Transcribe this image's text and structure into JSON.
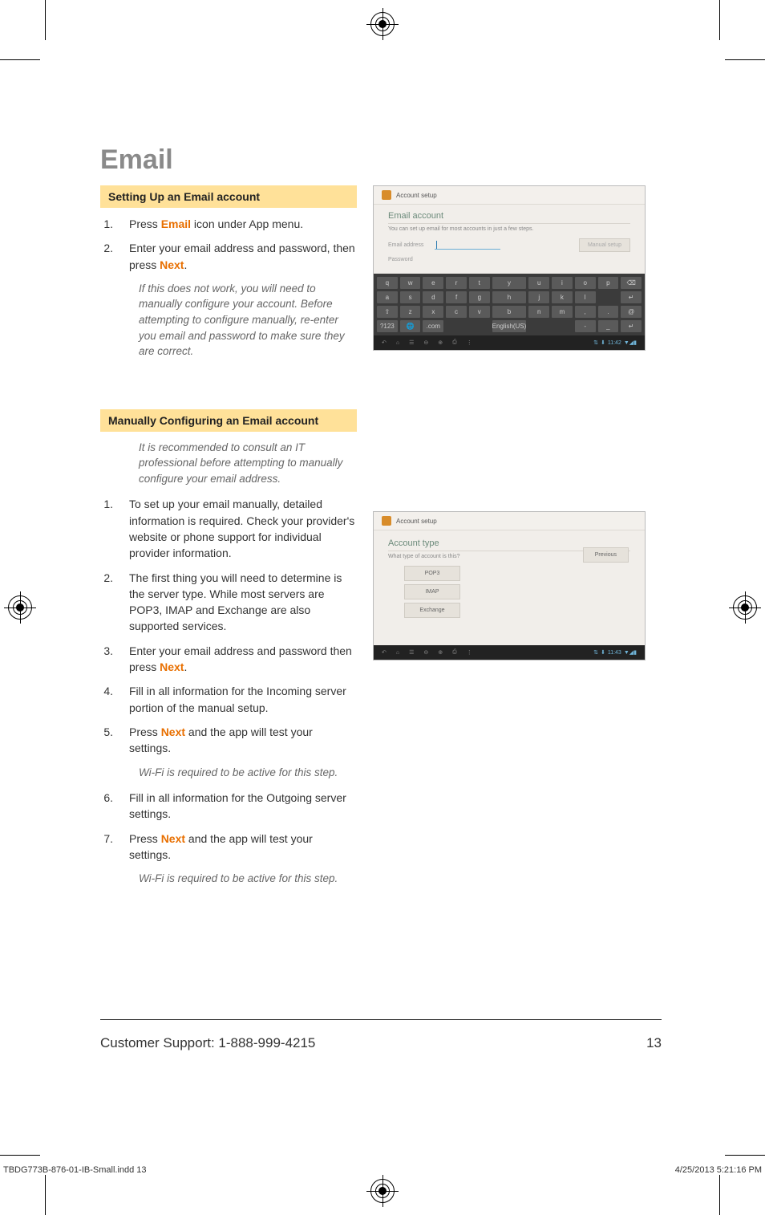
{
  "title": "Email",
  "section1": {
    "header": "Setting Up an Email account",
    "steps": [
      {
        "n": "1.",
        "pre": "Press ",
        "hl": "Email",
        "post": " icon under App menu."
      },
      {
        "n": "2.",
        "pre": "Enter your email address and password, then press ",
        "hl": "Next",
        "post": "."
      }
    ],
    "note": "If this does not work, you will need to manually configure your account. Before attempting to configure manually, re-enter you email and password to make sure they are correct."
  },
  "section2": {
    "header": "Manually Configuring an Email account",
    "intro_note": "It is recommended to consult an IT professional before attempting to manually configure your email address.",
    "steps": [
      {
        "n": "1.",
        "text": "To set up your email manually, detailed information is required. Check your provider's website or phone support for individual provider information."
      },
      {
        "n": "2.",
        "text": "The first thing you will need to determine is the server type. While most servers are POP3, IMAP and Exchange are also supported services."
      },
      {
        "n": "3.",
        "pre": "Enter your email address and password then press ",
        "hl": "Next",
        "post": "."
      },
      {
        "n": "4.",
        "text": "Fill in all information for the Incoming server portion of the manual setup."
      },
      {
        "n": "5.",
        "pre": "Press ",
        "hl": "Next",
        "post": " and the app will test your settings."
      },
      {
        "note": "Wi-Fi is required to be active for this step."
      },
      {
        "n": "6.",
        "text": "Fill in all information for the Outgoing server settings."
      },
      {
        "n": "7.",
        "pre": "Press ",
        "hl": "Next",
        "post": " and the app will test your settings."
      },
      {
        "note": "Wi-Fi is required to be active for this step."
      }
    ]
  },
  "mock1": {
    "titlebar": "Account setup",
    "heading": "Email account",
    "subtext": "You can set up email for most accounts in just a few steps.",
    "field1": "Email address",
    "field2": "Password",
    "button": "Manual setup",
    "keys_r1": [
      "q",
      "w",
      "e",
      "r",
      "t",
      "y",
      "u",
      "i",
      "o",
      "p",
      "⌫"
    ],
    "keys_r2": [
      "a",
      "s",
      "d",
      "f",
      "g",
      "h",
      "j",
      "k",
      "l",
      "",
      "↵"
    ],
    "keys_r3": [
      "⇧",
      "z",
      "x",
      "c",
      "v",
      "b",
      "n",
      "m",
      ",",
      ".",
      "@"
    ],
    "keys_r4": [
      "?123",
      "🌐",
      ".com",
      "",
      "",
      "English(US)",
      "",
      "",
      "-",
      "_",
      "↵"
    ],
    "time": "11:42"
  },
  "mock2": {
    "titlebar": "Account setup",
    "heading": "Account type",
    "question": "What type of account is this?",
    "prev": "Previous",
    "b1": "POP3",
    "b2": "IMAP",
    "b3": "Exchange",
    "time": "11:43"
  },
  "footer": {
    "support": "Customer Support: 1-888-999-4215",
    "page": "13"
  },
  "slug": {
    "file": "TBDG773B-876-01-IB-Small.indd   13",
    "date": "4/25/2013   5:21:16 PM"
  }
}
